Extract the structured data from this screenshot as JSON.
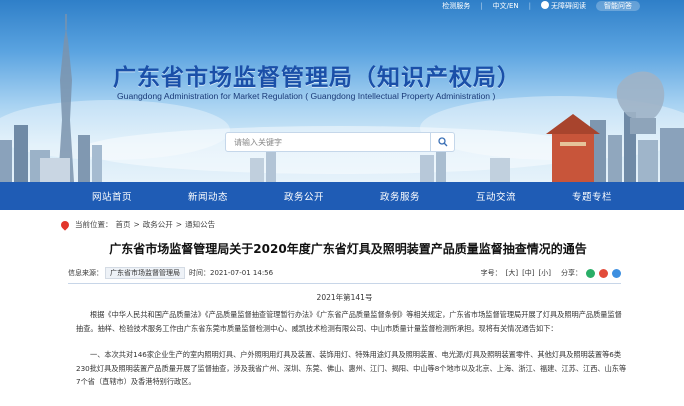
{
  "topbar": {
    "links": [
      "检测服务",
      "中文/EN",
      "无障碍阅读",
      "智能问答"
    ]
  },
  "header": {
    "title_cn": "广东省市场监督管理局（知识产权局）",
    "title_en": "Guangdong Administration for Market Regulation ( Guangdong Intellectual Property Administration )"
  },
  "search": {
    "placeholder": "请输入关键字"
  },
  "nav": {
    "items": [
      "网站首页",
      "新闻动态",
      "政务公开",
      "政务服务",
      "互动交流",
      "专题专栏"
    ]
  },
  "breadcrumb": {
    "label": "当前位置：",
    "items": [
      "首页",
      "政务公开",
      "通知公告"
    ],
    "separator": ">"
  },
  "article": {
    "title": "广东省市场监督管理局关于2020年度广东省灯具及照明装置产品质量监督抽查情况的通告",
    "source_label": "信息来源：",
    "source_value": "广东省市场监督管理局",
    "time_label": "时间：",
    "time_value": "2021-07-01 14:56",
    "font_label": "字号：",
    "font_sizes": [
      "[大]",
      "[中]",
      "[小]"
    ],
    "share_label": "分享：",
    "doc_number": "2021年第141号",
    "paragraph_1": "根据《中华人民共和国产品质量法》《产品质量监督抽查管理暂行办法》《广东省产品质量监督条例》等相关规定，广东省市场监督管理局开展了灯具及照明产品质量监督抽查。抽样、检验技术服务工作由广东省东莞市质量监督检测中心、威凯技术检测有限公司、中山市质量计量监督检测所承担。现将有关情况通告如下：",
    "paragraph_2": "一、本次共对146家企业生产的室内照明灯具、户外照明用灯具及装置、装饰用灯、特殊用途灯具及照明装置、电光源/灯具及照明装置零件、其他灯具及照明装置等6类230批灯具及照明装置产品质量开展了监督抽查，涉及我省广州、深圳、东莞、佛山、惠州、江门、揭阳、中山等8个地市以及北京、上海、浙江、福建、江苏、江西、山东等7个省（直辖市）及香港特别行政区。"
  },
  "colors": {
    "nav_bg": "#1f5cb5",
    "title_blue": "#1a4fa8",
    "accent_red": "#e2352b"
  }
}
